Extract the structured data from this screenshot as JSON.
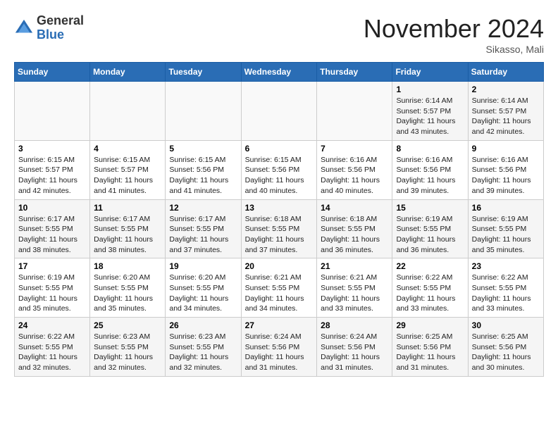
{
  "header": {
    "logo_general": "General",
    "logo_blue": "Blue",
    "month_title": "November 2024",
    "location": "Sikasso, Mali"
  },
  "weekdays": [
    "Sunday",
    "Monday",
    "Tuesday",
    "Wednesday",
    "Thursday",
    "Friday",
    "Saturday"
  ],
  "weeks": [
    [
      {
        "day": "",
        "info": ""
      },
      {
        "day": "",
        "info": ""
      },
      {
        "day": "",
        "info": ""
      },
      {
        "day": "",
        "info": ""
      },
      {
        "day": "",
        "info": ""
      },
      {
        "day": "1",
        "info": "Sunrise: 6:14 AM\nSunset: 5:57 PM\nDaylight: 11 hours\nand 43 minutes."
      },
      {
        "day": "2",
        "info": "Sunrise: 6:14 AM\nSunset: 5:57 PM\nDaylight: 11 hours\nand 42 minutes."
      }
    ],
    [
      {
        "day": "3",
        "info": "Sunrise: 6:15 AM\nSunset: 5:57 PM\nDaylight: 11 hours\nand 42 minutes."
      },
      {
        "day": "4",
        "info": "Sunrise: 6:15 AM\nSunset: 5:57 PM\nDaylight: 11 hours\nand 41 minutes."
      },
      {
        "day": "5",
        "info": "Sunrise: 6:15 AM\nSunset: 5:56 PM\nDaylight: 11 hours\nand 41 minutes."
      },
      {
        "day": "6",
        "info": "Sunrise: 6:15 AM\nSunset: 5:56 PM\nDaylight: 11 hours\nand 40 minutes."
      },
      {
        "day": "7",
        "info": "Sunrise: 6:16 AM\nSunset: 5:56 PM\nDaylight: 11 hours\nand 40 minutes."
      },
      {
        "day": "8",
        "info": "Sunrise: 6:16 AM\nSunset: 5:56 PM\nDaylight: 11 hours\nand 39 minutes."
      },
      {
        "day": "9",
        "info": "Sunrise: 6:16 AM\nSunset: 5:56 PM\nDaylight: 11 hours\nand 39 minutes."
      }
    ],
    [
      {
        "day": "10",
        "info": "Sunrise: 6:17 AM\nSunset: 5:55 PM\nDaylight: 11 hours\nand 38 minutes."
      },
      {
        "day": "11",
        "info": "Sunrise: 6:17 AM\nSunset: 5:55 PM\nDaylight: 11 hours\nand 38 minutes."
      },
      {
        "day": "12",
        "info": "Sunrise: 6:17 AM\nSunset: 5:55 PM\nDaylight: 11 hours\nand 37 minutes."
      },
      {
        "day": "13",
        "info": "Sunrise: 6:18 AM\nSunset: 5:55 PM\nDaylight: 11 hours\nand 37 minutes."
      },
      {
        "day": "14",
        "info": "Sunrise: 6:18 AM\nSunset: 5:55 PM\nDaylight: 11 hours\nand 36 minutes."
      },
      {
        "day": "15",
        "info": "Sunrise: 6:19 AM\nSunset: 5:55 PM\nDaylight: 11 hours\nand 36 minutes."
      },
      {
        "day": "16",
        "info": "Sunrise: 6:19 AM\nSunset: 5:55 PM\nDaylight: 11 hours\nand 35 minutes."
      }
    ],
    [
      {
        "day": "17",
        "info": "Sunrise: 6:19 AM\nSunset: 5:55 PM\nDaylight: 11 hours\nand 35 minutes."
      },
      {
        "day": "18",
        "info": "Sunrise: 6:20 AM\nSunset: 5:55 PM\nDaylight: 11 hours\nand 35 minutes."
      },
      {
        "day": "19",
        "info": "Sunrise: 6:20 AM\nSunset: 5:55 PM\nDaylight: 11 hours\nand 34 minutes."
      },
      {
        "day": "20",
        "info": "Sunrise: 6:21 AM\nSunset: 5:55 PM\nDaylight: 11 hours\nand 34 minutes."
      },
      {
        "day": "21",
        "info": "Sunrise: 6:21 AM\nSunset: 5:55 PM\nDaylight: 11 hours\nand 33 minutes."
      },
      {
        "day": "22",
        "info": "Sunrise: 6:22 AM\nSunset: 5:55 PM\nDaylight: 11 hours\nand 33 minutes."
      },
      {
        "day": "23",
        "info": "Sunrise: 6:22 AM\nSunset: 5:55 PM\nDaylight: 11 hours\nand 33 minutes."
      }
    ],
    [
      {
        "day": "24",
        "info": "Sunrise: 6:22 AM\nSunset: 5:55 PM\nDaylight: 11 hours\nand 32 minutes."
      },
      {
        "day": "25",
        "info": "Sunrise: 6:23 AM\nSunset: 5:55 PM\nDaylight: 11 hours\nand 32 minutes."
      },
      {
        "day": "26",
        "info": "Sunrise: 6:23 AM\nSunset: 5:55 PM\nDaylight: 11 hours\nand 32 minutes."
      },
      {
        "day": "27",
        "info": "Sunrise: 6:24 AM\nSunset: 5:56 PM\nDaylight: 11 hours\nand 31 minutes."
      },
      {
        "day": "28",
        "info": "Sunrise: 6:24 AM\nSunset: 5:56 PM\nDaylight: 11 hours\nand 31 minutes."
      },
      {
        "day": "29",
        "info": "Sunrise: 6:25 AM\nSunset: 5:56 PM\nDaylight: 11 hours\nand 31 minutes."
      },
      {
        "day": "30",
        "info": "Sunrise: 6:25 AM\nSunset: 5:56 PM\nDaylight: 11 hours\nand 30 minutes."
      }
    ]
  ]
}
